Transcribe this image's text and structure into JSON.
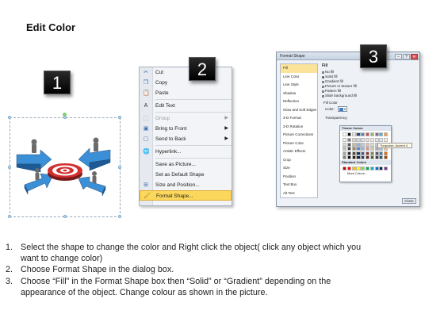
{
  "title": "Edit Color",
  "badges": [
    "1",
    "2",
    "3"
  ],
  "context_menu": {
    "items": [
      {
        "label": "Cut",
        "underline": "t",
        "icon": "scissors-icon",
        "glyph": "✂",
        "color": "#3a6fb0"
      },
      {
        "label": "Copy",
        "icon": "copy-icon",
        "glyph": "❐",
        "color": "#3a6fb0"
      },
      {
        "label": "Paste",
        "icon": "paste-icon",
        "glyph": "📋",
        "color": "#b07a2a"
      },
      {
        "sep": true
      },
      {
        "label": "Edit Text",
        "icon": "edit-text-icon",
        "glyph": "A",
        "color": "#333"
      },
      {
        "sep": true
      },
      {
        "label": "Group",
        "grey": true,
        "arrow": true,
        "icon": "group-icon",
        "glyph": "⬚",
        "color": "#999"
      },
      {
        "label": "Bring to Front",
        "arrow": true,
        "icon": "bring-front-icon",
        "glyph": "▣",
        "color": "#3a6fb0"
      },
      {
        "label": "Send to Back",
        "arrow": true,
        "icon": "send-back-icon",
        "glyph": "▢",
        "color": "#3a6fb0"
      },
      {
        "sep": true
      },
      {
        "label": "Hyperlink...",
        "icon": "hyperlink-icon",
        "glyph": "🌐",
        "color": "#2a8a2a"
      },
      {
        "sep": true
      },
      {
        "label": "Save as Picture...",
        "icon": "",
        "glyph": ""
      },
      {
        "label": "Set as Default Shape",
        "icon": "",
        "glyph": ""
      },
      {
        "label": "Size and Position...",
        "icon": "size-position-icon",
        "glyph": "⊞",
        "color": "#3a6fb0"
      },
      {
        "label": "Format Shape...",
        "highlight": true,
        "icon": "format-shape-icon",
        "glyph": "🖌",
        "color": "#b07a2a"
      }
    ]
  },
  "dialog": {
    "title": "Format Shape",
    "nav": [
      "Fill",
      "Line Color",
      "Line Style",
      "Shadow",
      "Reflection",
      "Glow and Soft Edges",
      "3-D Format",
      "3-D Rotation",
      "Picture Corrections",
      "Picture Color",
      "Artistic Effects",
      "Crop",
      "Size",
      "Position",
      "Text Box",
      "Alt Text"
    ],
    "fill_heading": "Fill",
    "options": [
      "No fill",
      "Solid fill",
      "Gradient fill",
      "Picture or texture fill",
      "Pattern fill",
      "Slide background fill"
    ],
    "selected_option": 1,
    "fill_color_label": "Fill Color",
    "color_label": "Color:",
    "transparency_label": "Transparency:",
    "close_label": "Close"
  },
  "palette": {
    "theme_label": "Theme Colors",
    "standard_label": "Standard Colors",
    "more_label": "More Colors...",
    "tooltip": "Turquoise, Accent 4",
    "theme_top": [
      "#ffffff",
      "#000000",
      "#eeece1",
      "#1f497d",
      "#4f81bd",
      "#c0504d",
      "#9bbb59",
      "#8064a2",
      "#4bacc6",
      "#f79646"
    ],
    "theme_shades": [
      [
        "#f2f2f2",
        "#7f7f7f",
        "#ddd9c3",
        "#c6d9f0",
        "#dbe5f1",
        "#f2dcdb",
        "#ebf1dd",
        "#e5e0ec",
        "#dbeef3",
        "#fdeada"
      ],
      [
        "#d8d8d8",
        "#595959",
        "#c4bd97",
        "#8db3e2",
        "#b8cce4",
        "#e5b9b7",
        "#d7e3bc",
        "#ccc1d9",
        "#b7dde8",
        "#fbd5b5"
      ],
      [
        "#bfbfbf",
        "#3f3f3f",
        "#938953",
        "#548dd4",
        "#95b3d7",
        "#d99694",
        "#c3d69b",
        "#b2a2c7",
        "#92cddc",
        "#fac08f"
      ],
      [
        "#a5a5a5",
        "#262626",
        "#494429",
        "#17365d",
        "#366092",
        "#953734",
        "#76923c",
        "#5f497a",
        "#31859b",
        "#e36c09"
      ],
      [
        "#7f7f7f",
        "#0c0c0c",
        "#1d1b10",
        "#0f243e",
        "#244061",
        "#632423",
        "#4f6128",
        "#3f3151",
        "#205867",
        "#974806"
      ]
    ],
    "standard": [
      "#c00000",
      "#ff0000",
      "#ffc000",
      "#ffff00",
      "#92d050",
      "#00b050",
      "#00b0f0",
      "#0070c0",
      "#002060",
      "#7030a0"
    ]
  },
  "instructions": [
    {
      "n": "1.",
      "lines": [
        "Select the shape to change the color and Right click the object( click any object which you",
        "want to change color)"
      ]
    },
    {
      "n": "2.",
      "lines": [
        "Choose Format Shape in the dialog box."
      ]
    },
    {
      "n": "3.",
      "lines": [
        "Choose “Fill” in the Format Shape box then “Solid” or “Gradient” depending on the",
        "appearance of the object. Change colour as shown in the picture."
      ]
    }
  ]
}
